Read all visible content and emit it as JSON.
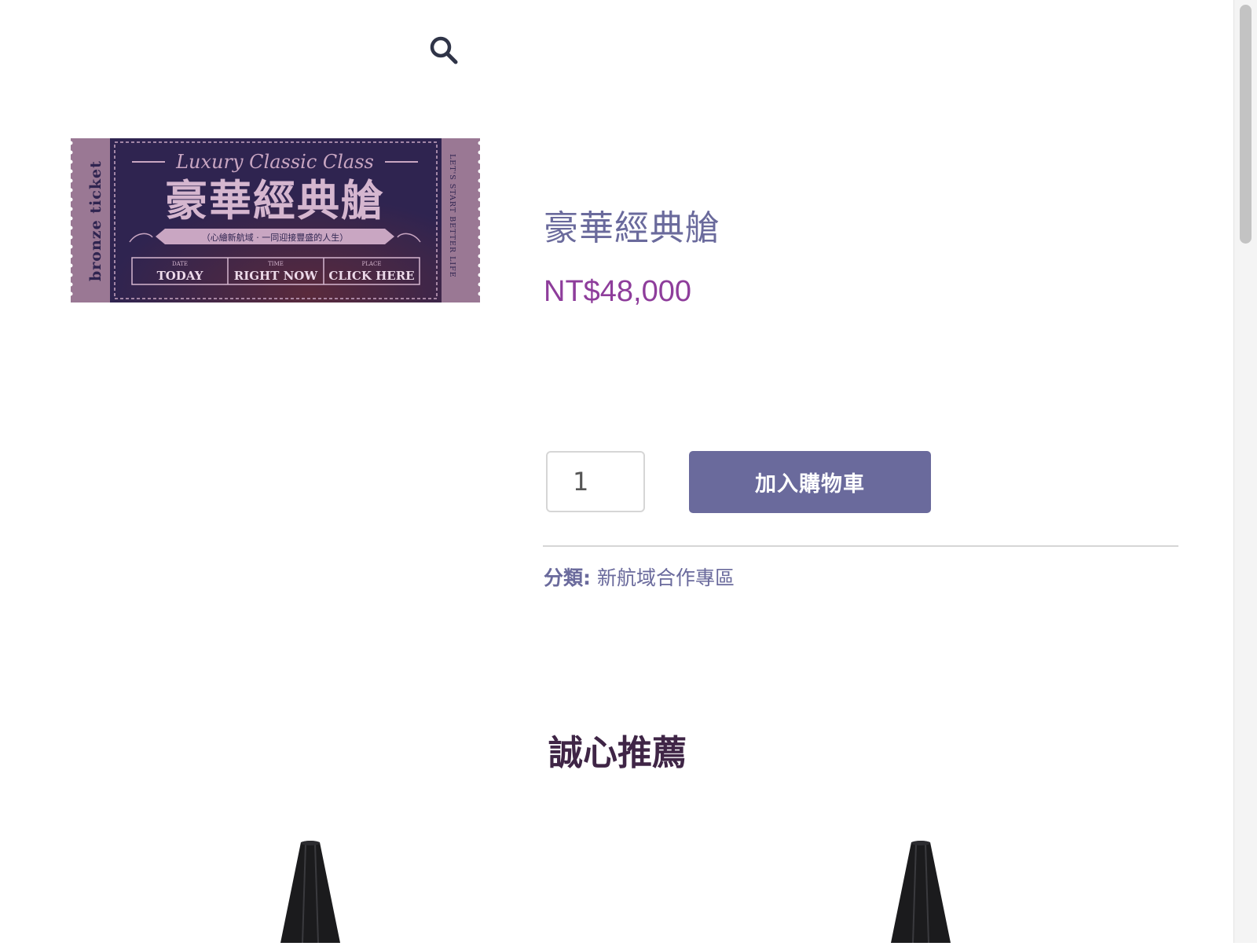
{
  "header": {
    "search_icon": "search-icon"
  },
  "product": {
    "title": "豪華經典艙",
    "price": "NT$48,000",
    "quantity": "1",
    "add_to_cart_label": "加入購物車",
    "category_label": "分類:",
    "category_value": "新航域合作專區"
  },
  "ticket": {
    "side_left": "bronze ticket",
    "side_right": "LET'S START BETTER LIFE",
    "script_title": "Luxury Classic Class",
    "title_zh": "豪華經典艙",
    "subtitle": "（心繪新航域 · 一同迎接豐盛的人生）",
    "cells": [
      {
        "small": "DATE",
        "big": "TODAY"
      },
      {
        "small": "TIME",
        "big": "RIGHT NOW"
      },
      {
        "small": "PLACE",
        "big": "CLICK HERE"
      }
    ]
  },
  "related": {
    "heading": "誠心推薦"
  },
  "colors": {
    "accent": "#6a6a9c",
    "price": "#8e3d9b",
    "heading": "#3f2546",
    "ticket_bg": "#2f2450",
    "ticket_edge": "#9a7894"
  }
}
